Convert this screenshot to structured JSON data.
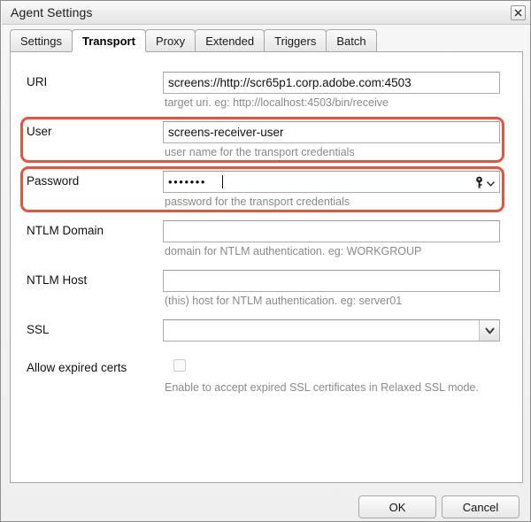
{
  "window": {
    "title": "Agent Settings",
    "close_icon": "close-icon"
  },
  "tabs": [
    {
      "label": "Settings",
      "active": false
    },
    {
      "label": "Transport",
      "active": true
    },
    {
      "label": "Proxy",
      "active": false
    },
    {
      "label": "Extended",
      "active": false
    },
    {
      "label": "Triggers",
      "active": false
    },
    {
      "label": "Batch",
      "active": false
    }
  ],
  "form": {
    "uri": {
      "label": "URI",
      "value": "screens://http://scr65p1.corp.adobe.com:4503",
      "placeholder": "",
      "hint": "target uri. eg: http://localhost:4503/bin/receive"
    },
    "user": {
      "label": "User",
      "value": "screens-receiver-user",
      "placeholder": "",
      "hint": "user name for the transport credentials",
      "highlighted": true
    },
    "password": {
      "label": "Password",
      "value": "•••••••",
      "placeholder": "",
      "hint": "password for the transport credentials",
      "highlighted": true,
      "key_icon": "key-icon",
      "chevron_icon": "chevron-down-icon"
    },
    "ntlm_domain": {
      "label": "NTLM Domain",
      "value": "",
      "placeholder": "",
      "hint": "domain for NTLM authentication. eg: WORKGROUP"
    },
    "ntlm_host": {
      "label": "NTLM Host",
      "value": "",
      "placeholder": "",
      "hint": "(this) host for NTLM authentication. eg: server01"
    },
    "ssl": {
      "label": "SSL",
      "value": "",
      "options": [
        ""
      ],
      "hint": ""
    },
    "allow_expired_certs": {
      "label": "Allow expired certs",
      "checked": false,
      "hint": "Enable to accept expired SSL certificates in Relaxed SSL mode."
    }
  },
  "footer": {
    "ok_label": "OK",
    "cancel_label": "Cancel"
  },
  "colors": {
    "annotation": "#e8533c",
    "hint_text": "#8a8a8a",
    "panel_background": "#ffffff"
  }
}
